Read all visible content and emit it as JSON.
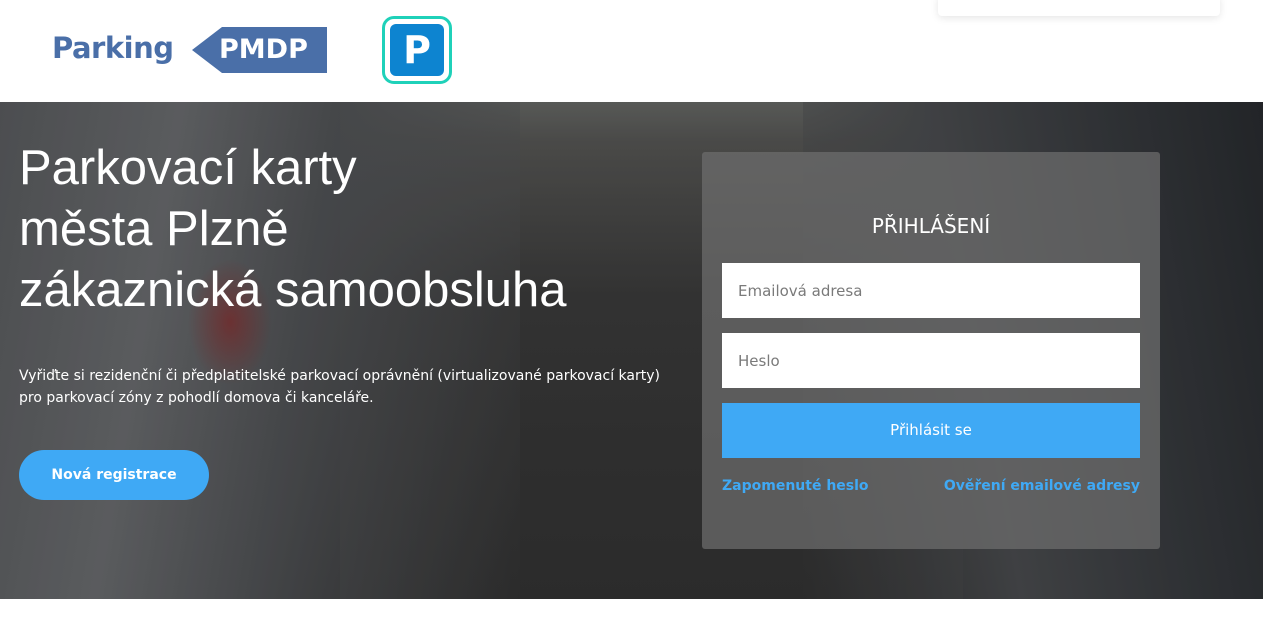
{
  "header": {
    "logo_text": "Parking",
    "logo_badge": "PMDP",
    "p_logo_letter": "P"
  },
  "hero": {
    "title_lines": [
      "Parkovací karty",
      "města Plzně",
      "zákaznická samoobsluha"
    ],
    "description_lines": [
      "Vyřiďte si rezidenční či předplatitelské parkovací oprávnění (virtualizované parkovací karty)",
      "pro parkovací zóny z pohodlí domova či kanceláře."
    ],
    "register_label": "Nová registrace"
  },
  "login": {
    "title": "PŘIHLÁŠENÍ",
    "email_placeholder": "Emailová adresa",
    "password_placeholder": "Heslo",
    "submit_label": "Přihlásit se",
    "forgot_password_label": "Zapomenuté heslo",
    "verify_email_label": "Ověření emailové adresy"
  },
  "colors": {
    "brand": "#4a6fa8",
    "accent": "#3fa9f5",
    "p_logo_border": "#1fd1b9",
    "p_logo_fill": "#0d84d0"
  }
}
